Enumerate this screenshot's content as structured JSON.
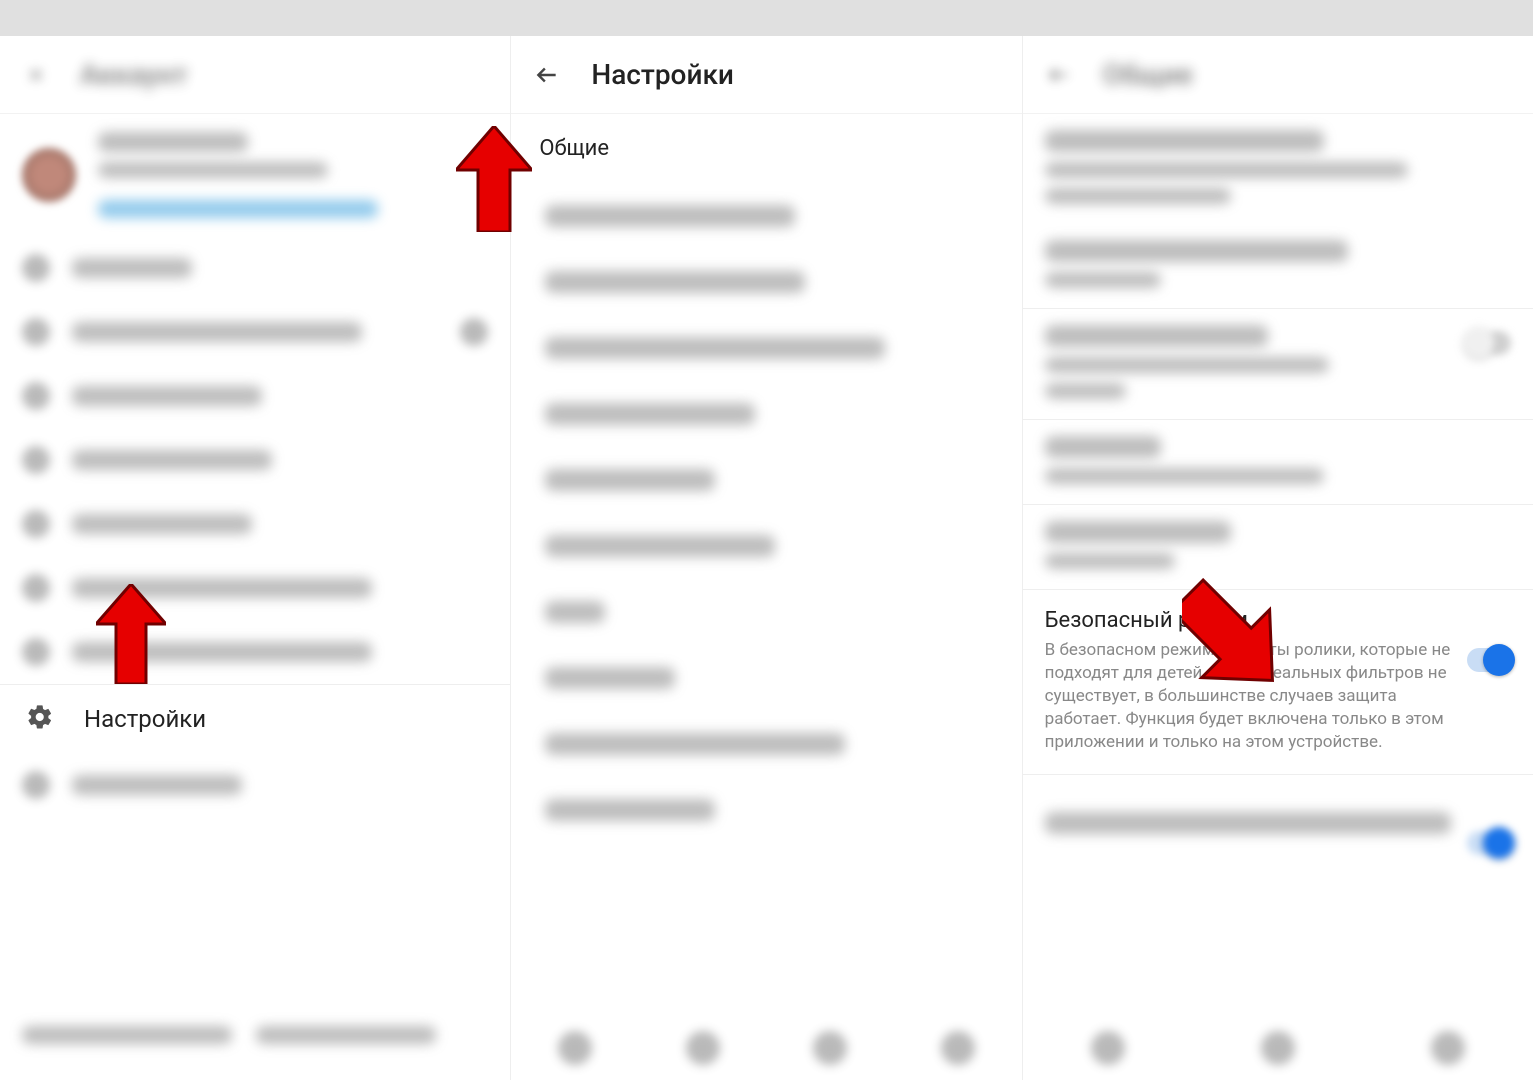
{
  "panel1": {
    "header_title": "Аккаунт",
    "settings_label": "Настройки"
  },
  "panel2": {
    "header_title": "Настройки",
    "general_item": "Общие"
  },
  "panel3": {
    "header_title": "Общие",
    "safe_mode": {
      "title": "Безопасный режим",
      "description": "В безопасном режиме скрыты ролики, которые не подходят для детей. Хотя идеальных фильтров не существует, в большинстве случаев защита работает. Функция будет включена только в этом приложении и только на этом устройстве."
    }
  }
}
